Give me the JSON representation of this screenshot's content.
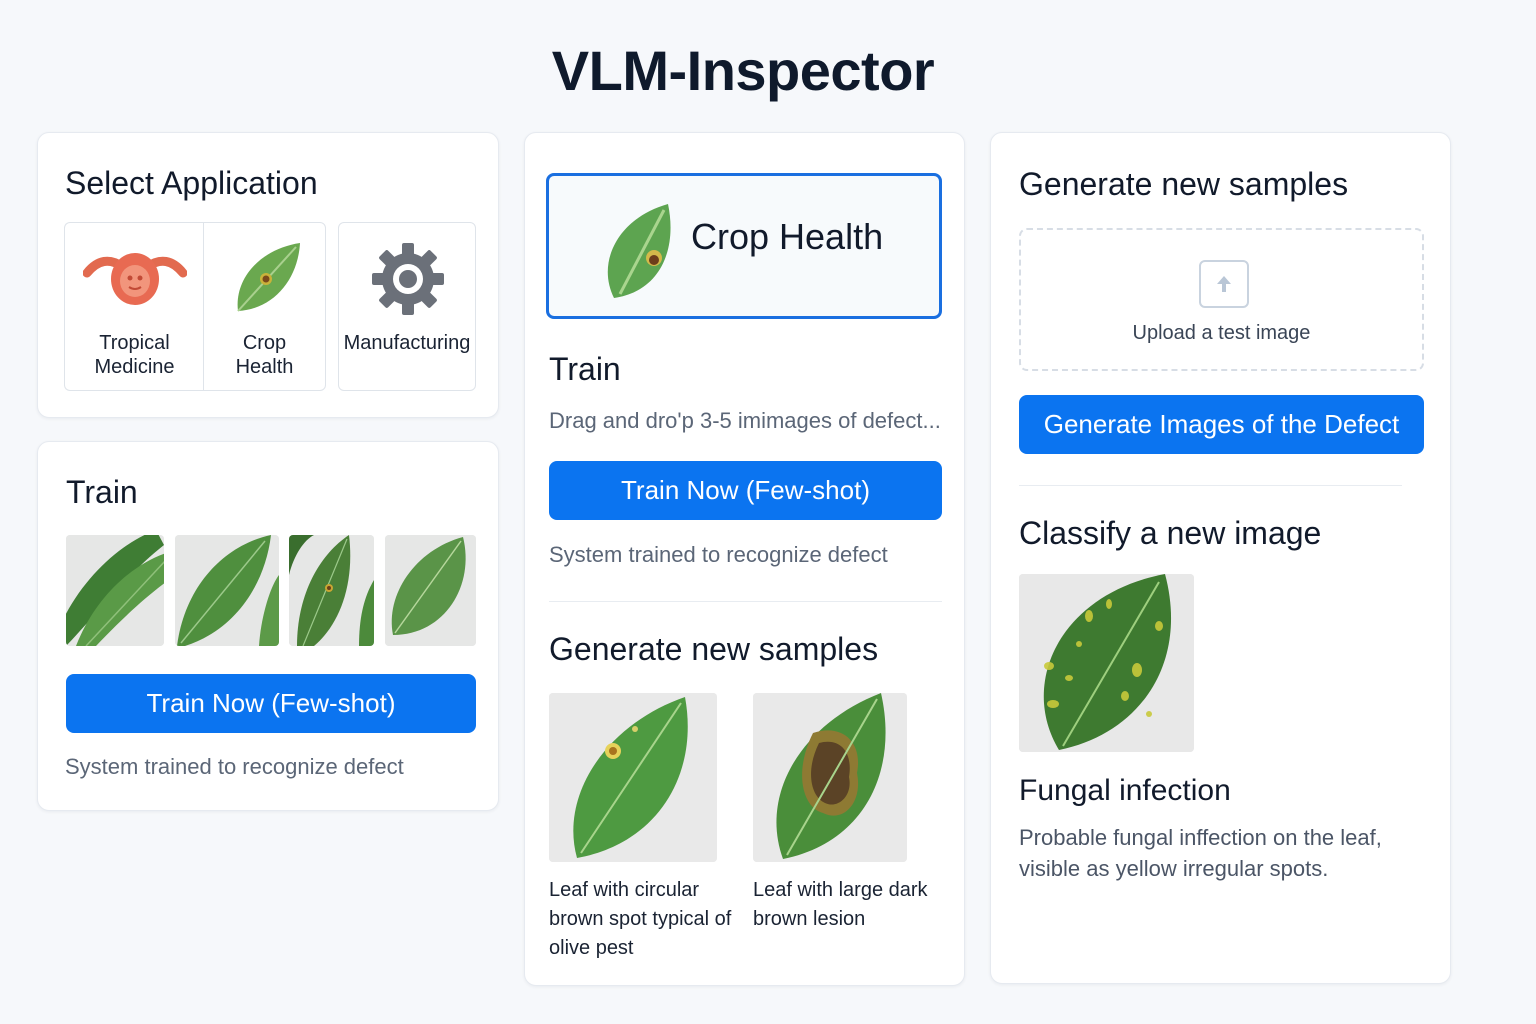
{
  "app": {
    "title": "VLM-Inspector"
  },
  "select_app": {
    "title": "Select Application",
    "apps": [
      {
        "label": "Tropical\nMedicine",
        "icon": "tropical-medicine-icon"
      },
      {
        "label": "Crop\nHealth",
        "icon": "leaf-icon"
      },
      {
        "label": "Manufacturing",
        "icon": "gear-icon"
      }
    ]
  },
  "train_left": {
    "title": "Train",
    "button": "Train Now (Few-shot)",
    "status": "System trained to recognize defect"
  },
  "center": {
    "selected_app": "Crop Health",
    "train_title": "Train",
    "drop_hint": "Drag and dro'p 3-5 imimages of defect...",
    "train_button": "Train Now (Few-shot)",
    "train_status": "System trained to recognize defect",
    "generate_title": "Generate new samples",
    "samples": [
      {
        "caption": "Leaf with circular brown spot typical of olive pest"
      },
      {
        "caption": "Leaf with large dark brown lesion"
      }
    ]
  },
  "right": {
    "generate_title": "Generate new samples",
    "upload_label": "Upload a test image",
    "generate_button": "Generate Images of the Defect",
    "classify_title": "Classify a new image",
    "result_title": "Fungal infection",
    "result_text": "Probable fungal inffection on the leaf, visible as yellow irregular spots."
  },
  "colors": {
    "primary": "#0b74f0",
    "leaf": "#4f9a45",
    "card_border": "#e6eaf0"
  }
}
